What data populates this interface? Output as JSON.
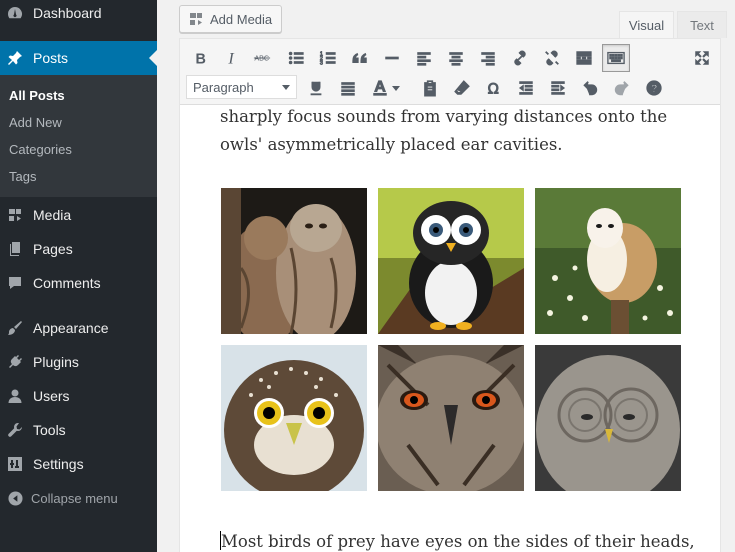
{
  "sidebar": {
    "dashboard": "Dashboard",
    "posts": "Posts",
    "submenu": [
      "All Posts",
      "Add New",
      "Categories",
      "Tags"
    ],
    "media": "Media",
    "pages": "Pages",
    "comments": "Comments",
    "appearance": "Appearance",
    "plugins": "Plugins",
    "users": "Users",
    "tools": "Tools",
    "settings": "Settings",
    "collapse": "Collapse menu"
  },
  "editor": {
    "add_media": "Add Media",
    "tab_visual": "Visual",
    "tab_text": "Text",
    "format_select": "Paragraph",
    "para1": "sharply focus sounds from varying distances onto the owls' asymmetrically placed ear cavities.",
    "para2": "Most birds of prey have eyes on the sides of their heads,"
  },
  "gallery": [
    {
      "name": "tawny-owls-photo"
    },
    {
      "name": "plush-owl-toy-photo"
    },
    {
      "name": "barn-owl-photo"
    },
    {
      "name": "pygmy-owl-photo"
    },
    {
      "name": "eagle-owl-photo"
    },
    {
      "name": "great-grey-owl-photo"
    }
  ],
  "colors": {
    "sidebar_bg": "#23282d",
    "submenu_bg": "#32373c",
    "accent": "#0073aa"
  }
}
